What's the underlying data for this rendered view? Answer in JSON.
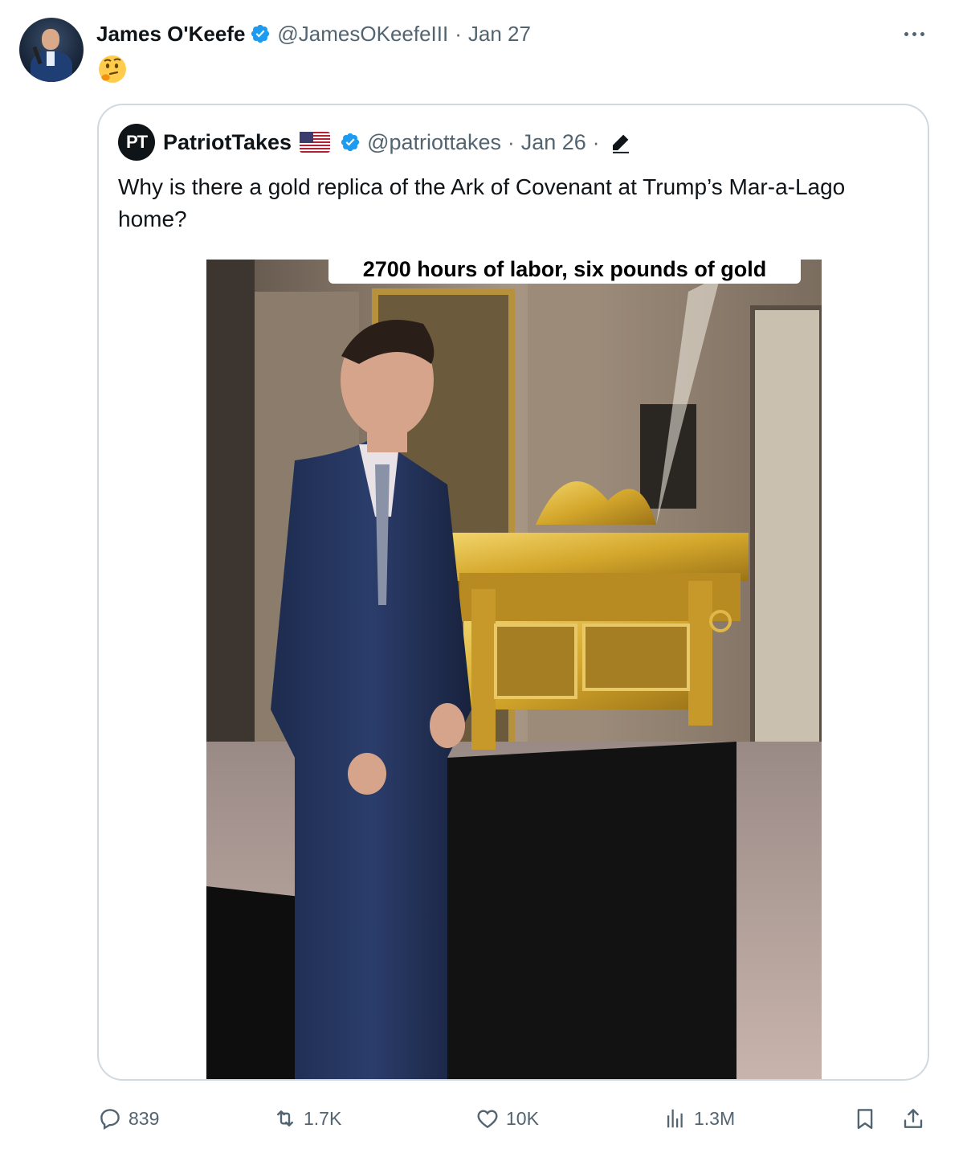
{
  "tweet": {
    "author_name": "James O'Keefe",
    "handle": "@JamesOKeefeIII",
    "separator": "·",
    "date": "Jan 27",
    "text_emoji": "🤔"
  },
  "quote": {
    "logo_text": "PT",
    "author_name": "PatriotTakes",
    "handle": "@patriottakes",
    "separator": "·",
    "date": "Jan 26",
    "separator2": "·",
    "text": "Why is there a gold replica of the Ark of Covenant at Trump’s Mar-a-Lago home?",
    "media_caption": "2700 hours of labor, six pounds of gold"
  },
  "actions": {
    "replies": "839",
    "retweets": "1.7K",
    "likes": "10K",
    "views": "1.3M"
  },
  "colors": {
    "verified": "#1d9bf0",
    "secondary_text": "#536471",
    "border": "#cfd9de",
    "gold": "#d4a72c"
  },
  "icons": [
    "verified-badge-icon",
    "more-icon",
    "thinking-face-emoji",
    "us-flag-icon",
    "pencil-icon",
    "reply-icon",
    "retweet-icon",
    "like-icon",
    "views-icon",
    "bookmark-icon",
    "share-icon"
  ]
}
